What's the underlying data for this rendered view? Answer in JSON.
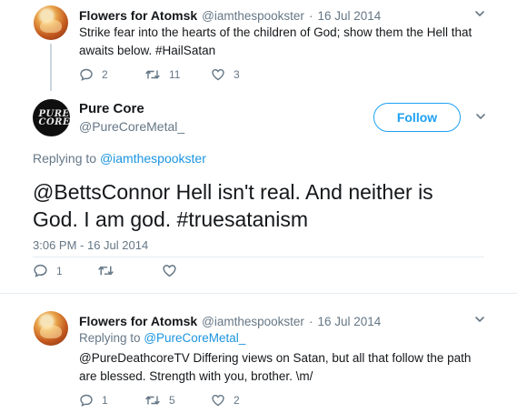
{
  "reply_top": {
    "display_name": "Flowers for Atomsk",
    "handle": "@iamthespookster",
    "dot": "·",
    "date": "16 Jul 2014",
    "text": "Strike fear into the hearts of the children of God; show them the Hell that awaits below. #HailSatan",
    "replies": "2",
    "retweets": "11",
    "likes": "3"
  },
  "main_tweet": {
    "display_name": "Pure Core",
    "handle": "@PureCoreMetal_",
    "avatar_text": "PURE CORE",
    "follow_label": "Follow",
    "replying_to_prefix": "Replying to",
    "replying_to_handle": "@iamthespookster",
    "text": "@BettsConnor Hell isn't real. And neither is God. I am god. #truesatanism",
    "timestamp": "3:06 PM - 16 Jul 2014",
    "replies": "1",
    "retweets": "",
    "likes": ""
  },
  "reply_bottom": {
    "display_name": "Flowers for Atomsk",
    "handle": "@iamthespookster",
    "dot": "·",
    "date": "16 Jul 2014",
    "replying_to_prefix": "Replying to",
    "replying_to_handle": "@PureCoreMetal_",
    "text": "@PureDeathcoreTV Differing views on Satan, but all that follow the path are blessed. Strength with you, brother. \\m/",
    "replies": "1",
    "retweets": "5",
    "likes": "2"
  },
  "colors": {
    "accent": "#1da1f2",
    "link": "#1b95e0",
    "muted": "#657786",
    "thread_line": "#ccd6dd"
  },
  "icons": [
    "reply-icon",
    "retweet-icon",
    "like-icon",
    "chevron-down-icon"
  ]
}
